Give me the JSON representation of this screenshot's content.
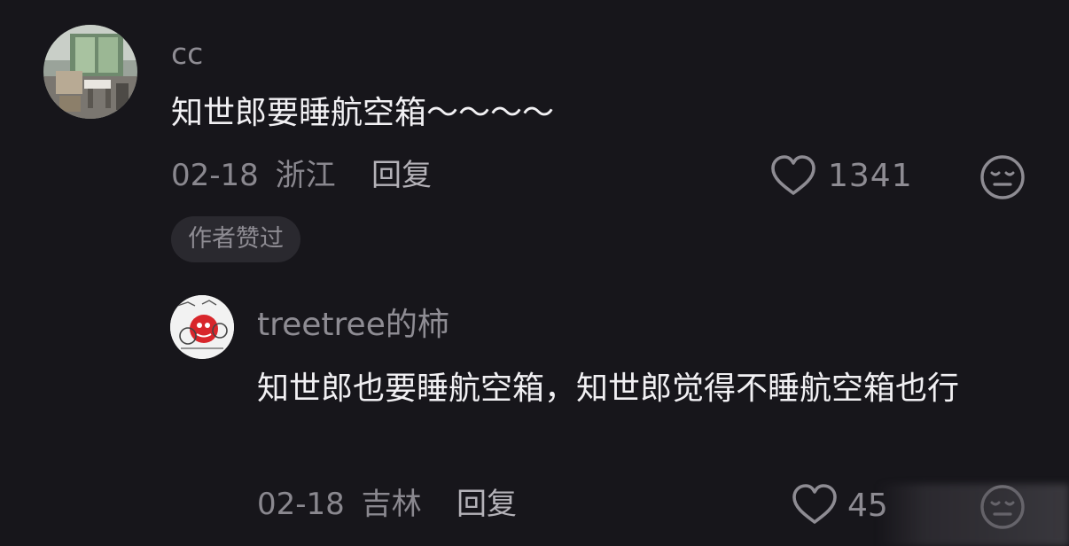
{
  "comment": {
    "username": "cc",
    "text": "知世郎要睡航空箱～～～～",
    "date": "02-18",
    "location": "浙江",
    "reply_label": "回复",
    "like_count": "1341",
    "author_badge": "作者赞过"
  },
  "reply": {
    "username": "treetree的柿",
    "text": "知世郎也要睡航空箱，知世郎觉得不睡航空箱也行",
    "date": "02-18",
    "location": "吉林",
    "reply_label": "回复",
    "like_count": "45"
  },
  "icons": {
    "like": "heart-outline-icon",
    "reaction": "neutral-face-icon"
  },
  "colors": {
    "background": "#17161b",
    "primary_text": "#f1f0f3",
    "secondary_text": "#8e8c93",
    "badge_bg": "#2a292f"
  }
}
